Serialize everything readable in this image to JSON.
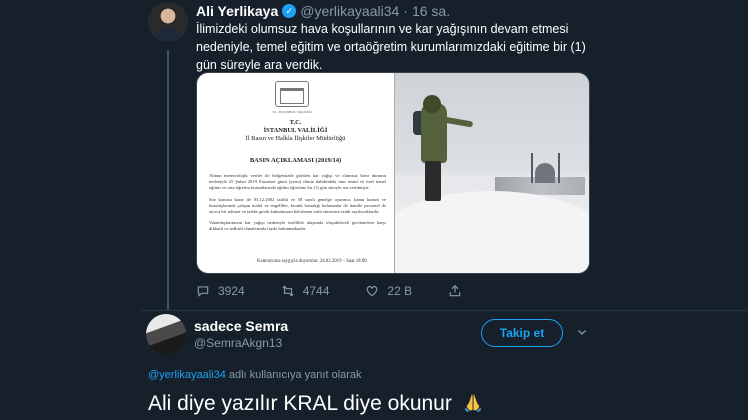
{
  "original_tweet": {
    "author_name": "Ali Yerlikaya",
    "handle": "@yerlikayaali34",
    "separator": "·",
    "time": "16 sa.",
    "text": "İlimizdeki olumsuz hava koşullarının ve kar yağışının devam etmesi nedeniyle, temel eğitim ve ortaöğretim kurumlarımızdaki eğitime bir (1) gün süreyle ara verdik.",
    "document": {
      "crest_caption": "T.C. İSTANBUL VALİLİĞİ",
      "line1": "T.C.",
      "line2": "İSTANBUL VALİLİĞİ",
      "line3": "İl Basın ve Halkla İlişkiler Müdürlüğü",
      "title": "BASIN AÇIKLAMASI (2019/14)",
      "para1": "Alınan meteorolojik veriler ile bölgemizde görülen kar yağışı ve olumsuz hava durumu nedeniyle 25 Şubat 2019 Pazartesi günü (yarın) ilimiz dahilindeki tüm resmi ve özel temel eğitim ve orta öğretim kurumlarında eğitim öğretime bir (1) gün süreyle ara verilmiştir.",
      "para2": "Söz konusu karar ile 03.12.2002 tarihli ve 58 sayılı genelge uyarınca, kamu kurum ve kuruluşlarında çalışan malul ve engelliler, kronik hastalığı bulunanlar ile hamile personel de ayrıca bir talimat ve talebe gerek kalmaksızın belirlenen tarih süresince izinli sayılacaklardır.",
      "para3": "Vatandaşlarımızın kar yağışı nedeniyle özellikle ulaşımda oluşabilecek gecikmelere karşı dikkatli ve tedbirli olmalarında fayda bulunmaktadır.",
      "footer": "Kamuoyuna saygıyla duyurulur. 24.02.2019 – Saat 18:00"
    },
    "stats": {
      "replies": "3924",
      "retweets": "4744",
      "likes": "22 B"
    }
  },
  "reply_tweet": {
    "author_name": "sadece Semra",
    "handle": "@SemraAkgn13",
    "follow_label": "Takip et",
    "reply_to_mention": "@yerlikayaali34",
    "reply_to_suffix": " adlı kullanıcıya yanıt olarak",
    "text": "Ali diye yazılır KRAL diye okunur"
  },
  "colors": {
    "background": "#15202b",
    "accent": "#1da1f2",
    "secondary_text": "#8899a6"
  },
  "icons": [
    "verified-badge-icon",
    "reply-icon",
    "retweet-icon",
    "like-icon",
    "share-icon",
    "chevron-down-icon",
    "praying-hands-emoji"
  ]
}
